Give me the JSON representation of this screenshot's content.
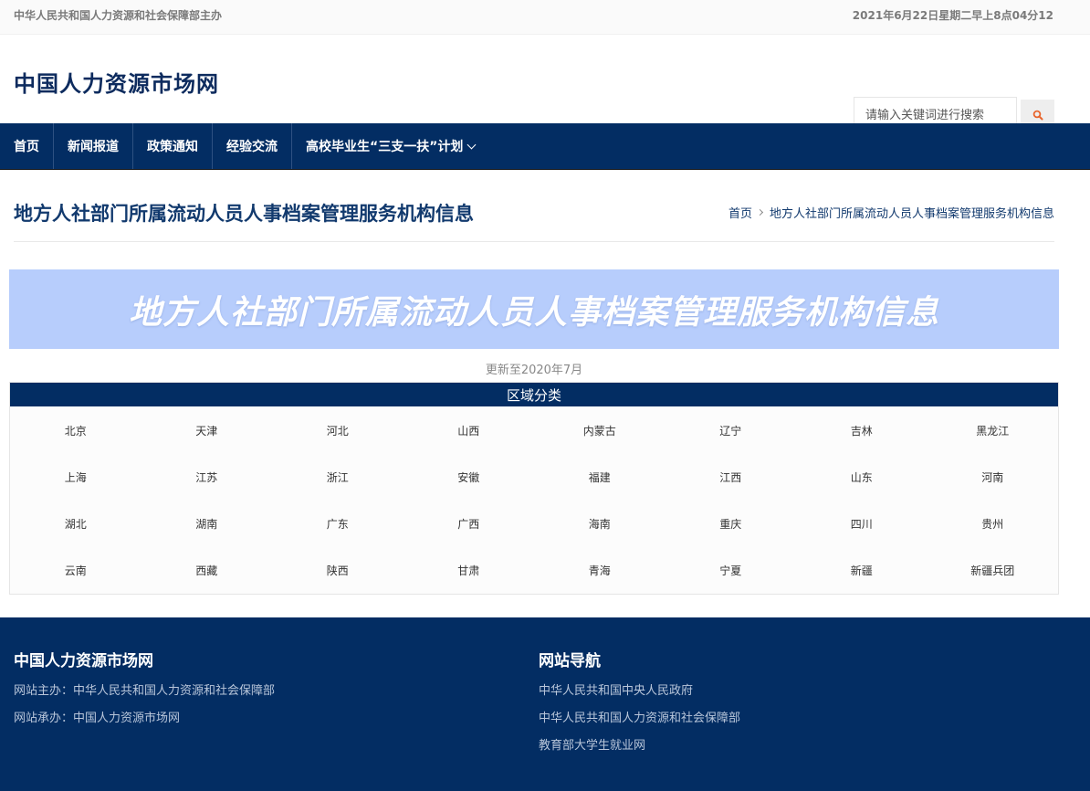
{
  "topbar": {
    "sponsor": "中华人民共和国人力资源和社会保障部主办",
    "datetime": "2021年6月22日星期二早上8点04分12"
  },
  "header": {
    "site_title": "中国人力资源市场网",
    "search_placeholder": "请输入关键词进行搜索",
    "search_icon": "search-icon"
  },
  "nav": {
    "items": [
      "首页",
      "新闻报道",
      "政策通知",
      "经验交流",
      "高校毕业生“三支一扶”计划"
    ]
  },
  "page": {
    "title": "地方人社部门所属流动人员人事档案管理服务机构信息",
    "breadcrumb_home": "首页",
    "breadcrumb_current": "地方人社部门所属流动人员人事档案管理服务机构信息"
  },
  "banner": {
    "title": "地方人社部门所属流动人员人事档案管理服务机构信息",
    "update_note": "更新至2020年7月"
  },
  "regions": {
    "header": "区域分类",
    "items": [
      "北京",
      "天津",
      "河北",
      "山西",
      "内蒙古",
      "辽宁",
      "吉林",
      "黑龙江",
      "上海",
      "江苏",
      "浙江",
      "安徽",
      "福建",
      "江西",
      "山东",
      "河南",
      "湖北",
      "湖南",
      "广东",
      "广西",
      "海南",
      "重庆",
      "四川",
      "贵州",
      "云南",
      "西藏",
      "陕西",
      "甘肃",
      "青海",
      "宁夏",
      "新疆",
      "新疆兵团"
    ]
  },
  "footer": {
    "left_heading": "中国人力资源市场网",
    "host": "网站主办：中华人民共和国人力资源和社会保障部",
    "operator": "网站承办：中国人力资源市场网",
    "right_heading": "网站导航",
    "links": [
      "中华人民共和国中央人民政府",
      "中华人民共和国人力资源和社会保障部",
      "教育部大学生就业网"
    ]
  },
  "colors": {
    "nav_bg": "#032d63",
    "banner_bg": "#b7cdfc",
    "title_text": "#123a6e",
    "search_icon": "#e8642c"
  }
}
